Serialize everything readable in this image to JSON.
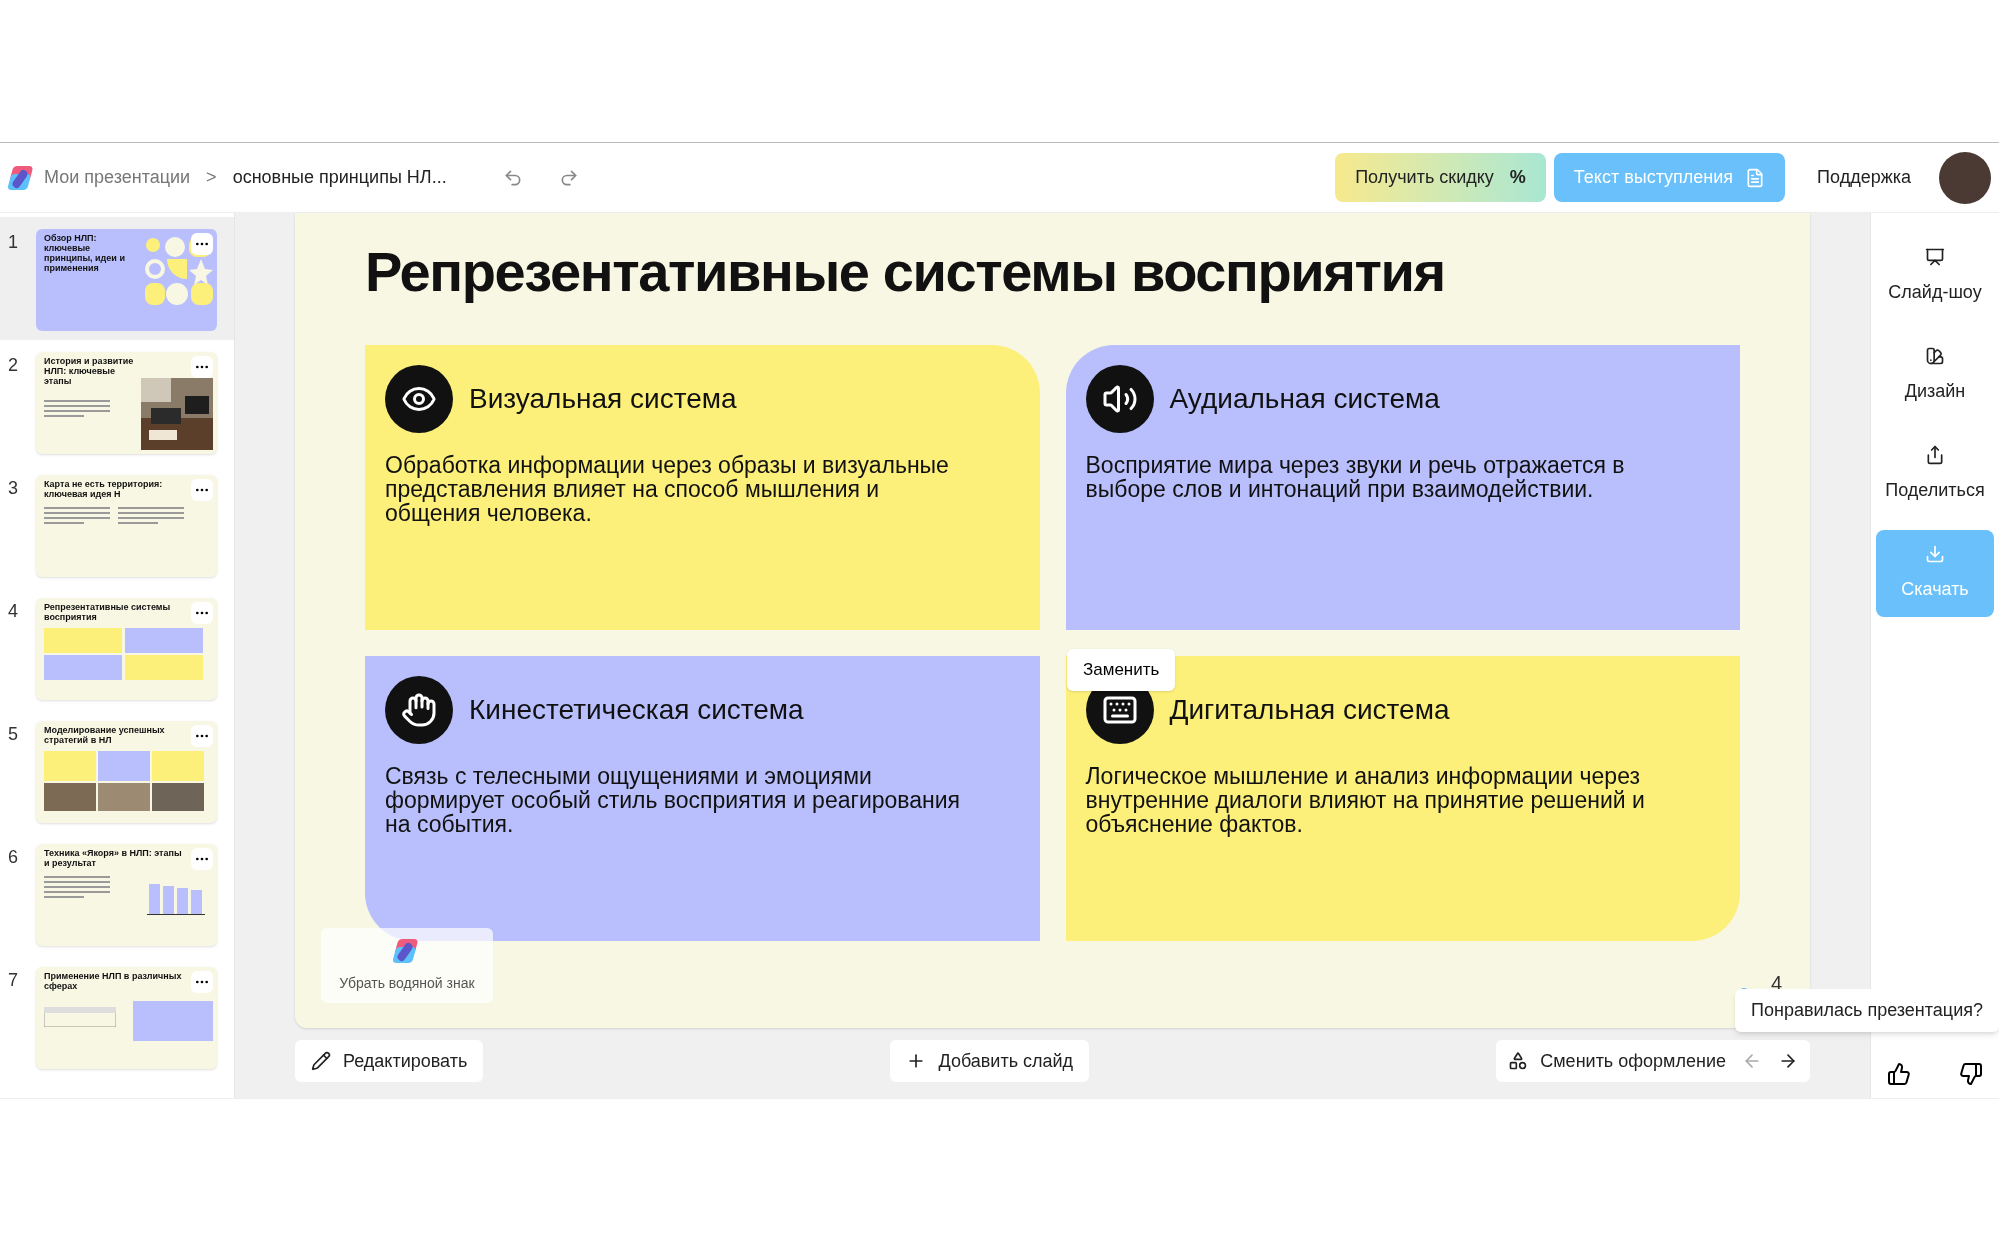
{
  "breadcrumb": {
    "root": "Мои презентации",
    "separator": ">",
    "current": "основные принципы НЛ..."
  },
  "top_buttons": {
    "discount": "Получить скидку",
    "discount_icon": "%",
    "speech": "Текст выступления",
    "support": "Поддержка"
  },
  "thumbnails": [
    {
      "number": "1",
      "title": "Обзор НЛП: ключевые принципы, идеи и применения",
      "selected": true,
      "kind": "cover"
    },
    {
      "number": "2",
      "title": "История и развитие НЛП: ключевые этапы",
      "selected": false
    },
    {
      "number": "3",
      "title": "Карта не есть территория: ключевая идея Н",
      "selected": false,
      "kind": "columns"
    },
    {
      "number": "4",
      "title": "Репрезентативные системы восприятия",
      "selected": false,
      "kind": "grid"
    },
    {
      "number": "5",
      "title": "Моделирование успешных стратегий в НЛ",
      "selected": false,
      "kind": "photos"
    },
    {
      "number": "6",
      "title": "Техника «Якоря» в НЛП: этапы и результат",
      "selected": false,
      "kind": "chart"
    },
    {
      "number": "7",
      "title": "Применение НЛП в различных сферах",
      "selected": false,
      "kind": "table"
    }
  ],
  "slide": {
    "title": "Репрезентативные системы восприятия",
    "number": "4",
    "cards": [
      {
        "title": "Визуальная система",
        "text": "Обработка информации через образы и визуальные представления влияет на способ мышления и общения человека.",
        "color": "#fcf07a"
      },
      {
        "title": "Аудиальная система",
        "text": "Восприятие мира через звуки и речь отражается в выборе слов и интонаций при взаимодействии.",
        "color": "#b9bffc"
      },
      {
        "title": "Кинестетическая система",
        "text": "Связь с телесными ощущениями и эмоциями формирует особый стиль восприятия и реагирования на события.",
        "color": "#b9bffc"
      },
      {
        "title": "Дигитальная система",
        "text": "Логическое мышление и анализ информации через внутренние диалоги влияют на принятие решений и объяснение фактов.",
        "color": "#fcf07a"
      }
    ],
    "replace_button": "Заменить",
    "watermark_button": "Убрать водяной знак"
  },
  "bottom_bar": {
    "edit": "Редактировать",
    "add": "Добавить слайд",
    "restyle": "Сменить оформление"
  },
  "right_panel": [
    {
      "label": "Слайд-шоу",
      "kind": "plain"
    },
    {
      "label": "Дизайн",
      "kind": "plain"
    },
    {
      "label": "Поделиться",
      "kind": "plain"
    },
    {
      "label": "Скачать",
      "kind": "primary"
    }
  ],
  "feedback": {
    "question": "Понравилась презентация?"
  }
}
